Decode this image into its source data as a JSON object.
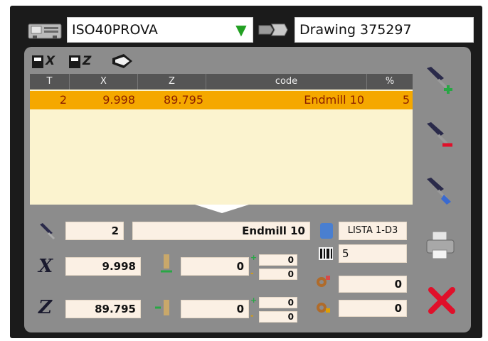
{
  "header": {
    "program_name": "ISO40PROVA",
    "drawing_label": "Drawing 375297"
  },
  "toolbar": {
    "x_label": "X",
    "z_label": "Z"
  },
  "table": {
    "columns": [
      "T",
      "X",
      "Z",
      "code",
      "%"
    ],
    "rows": [
      {
        "t": "2",
        "x": "9.998",
        "z": "89.795",
        "code": "Endmill 10",
        "pct": "5"
      }
    ]
  },
  "details": {
    "tool_number": "2",
    "tool_code": "Endmill 10",
    "list_name": "LISTA 1-D3",
    "x_value": "9.998",
    "z_value": "89.795",
    "x_offset": "0",
    "z_offset": "0",
    "x_plus": "0",
    "x_minus": "0",
    "z_plus": "0",
    "z_minus": "0",
    "count": "5",
    "value_a": "0",
    "value_b": "0"
  },
  "axis_labels": {
    "x": "X",
    "z": "Z"
  },
  "colors": {
    "selected_row": "#f5a800",
    "row_text": "#8a1d00",
    "table_bg": "#fbf3cf",
    "panel": "#8c8c8c",
    "accept_green": "#22a022",
    "delete_red": "#e0102a"
  },
  "icons": [
    "machine-icon",
    "chevron-down-icon",
    "drawing-icon",
    "measure-x-icon",
    "measure-z-icon",
    "tool-holder-icon",
    "add-tool-icon",
    "remove-tool-icon",
    "edit-tool-icon",
    "print-icon",
    "delete-icon",
    "probe-icon",
    "barcode-icon",
    "gear-icon",
    "offset-icon"
  ]
}
